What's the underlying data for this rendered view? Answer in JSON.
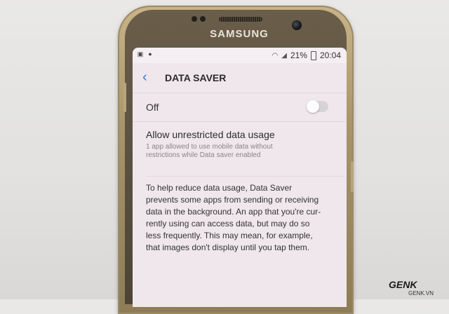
{
  "device": {
    "brand": "SAMSUNG"
  },
  "status_bar": {
    "battery": "21%",
    "time": "20:04"
  },
  "app_bar": {
    "title": "DATA SAVER"
  },
  "data_saver": {
    "state_label": "Off",
    "enabled": false
  },
  "unrestricted": {
    "title": "Allow unrestricted data usage",
    "subtitle_lines": [
      "1 app allowed to use mobile data without",
      "restrictions while Data saver enabled"
    ]
  },
  "description_lines": [
    "To help reduce data usage, Data Saver",
    "prevents some apps from sending or receiving",
    "data in the background. An app that you're cur-",
    "rently using can access data, but may do so",
    "less frequently. This may mean, for example,",
    "that images don't display until you tap them."
  ],
  "watermark": {
    "logo": "GENK",
    "url": "GENK.VN"
  },
  "icons": [
    "gallery-icon",
    "sync-icon",
    "wifi-icon",
    "signal-icon",
    "battery-icon",
    "back-arrow-icon"
  ]
}
